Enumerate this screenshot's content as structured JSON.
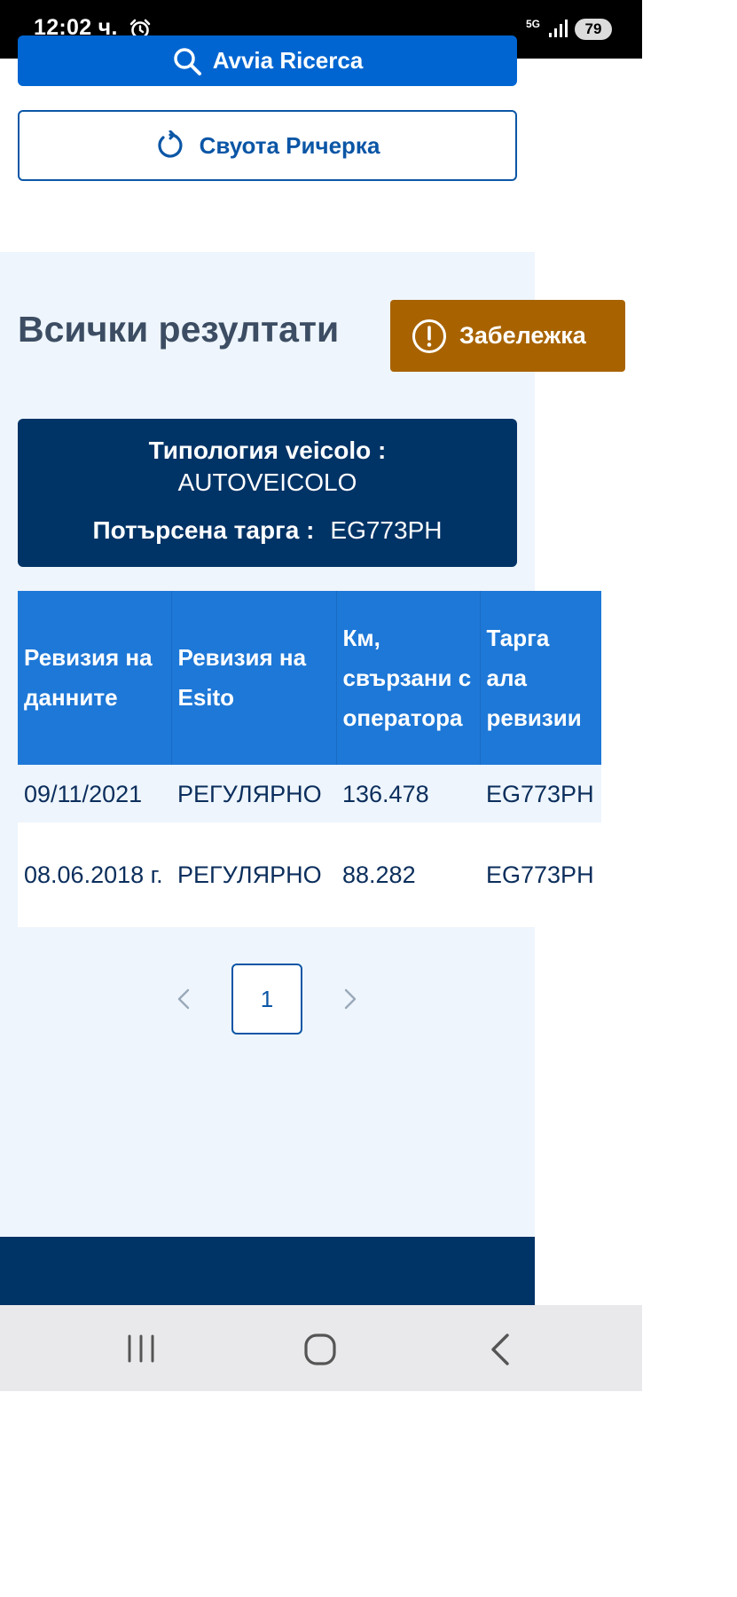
{
  "status_bar": {
    "time": "12:02 ч.",
    "network": "5G",
    "battery": "79"
  },
  "buttons": {
    "search_label": "Avvia Ricerca",
    "reset_label": "Свуота Ричерка"
  },
  "results": {
    "title": "Всички резултати",
    "note_label": "Забележка"
  },
  "vehicle": {
    "type_label": "Типология veicolo :",
    "type_value": "AUTOVEICOLO",
    "plate_label": "Потърсена тарга :",
    "plate_value": "EG773PH"
  },
  "table": {
    "headers": [
      "Ревизия на данните",
      "Ревизия на Esito",
      "Км, свързани с оператора",
      "Тарга ала ревизии"
    ],
    "rows": [
      [
        "09/11/2021",
        "РЕГУЛЯРНО",
        "136.478",
        "EG773PH"
      ],
      [
        "08.06.2018 г.",
        "РЕГУЛЯРНО",
        "88.282",
        "EG773PH"
      ]
    ]
  },
  "pagination": {
    "current_page": "1"
  },
  "icons": {
    "search": "search-icon",
    "reset": "refresh-icon",
    "note": "exclamation-circle-icon",
    "prev": "chevron-left-icon",
    "next": "chevron-right-icon",
    "alarm": "alarm-icon",
    "signal": "signal-icon",
    "nav_recents": "recents-icon",
    "nav_home": "home-icon",
    "nav_back": "back-icon"
  },
  "colors": {
    "primary": "#0065d1",
    "dark_navy": "#003366",
    "table_header": "#1e78d7",
    "note_orange": "#a86300",
    "panel_bg": "#eef5fc"
  }
}
